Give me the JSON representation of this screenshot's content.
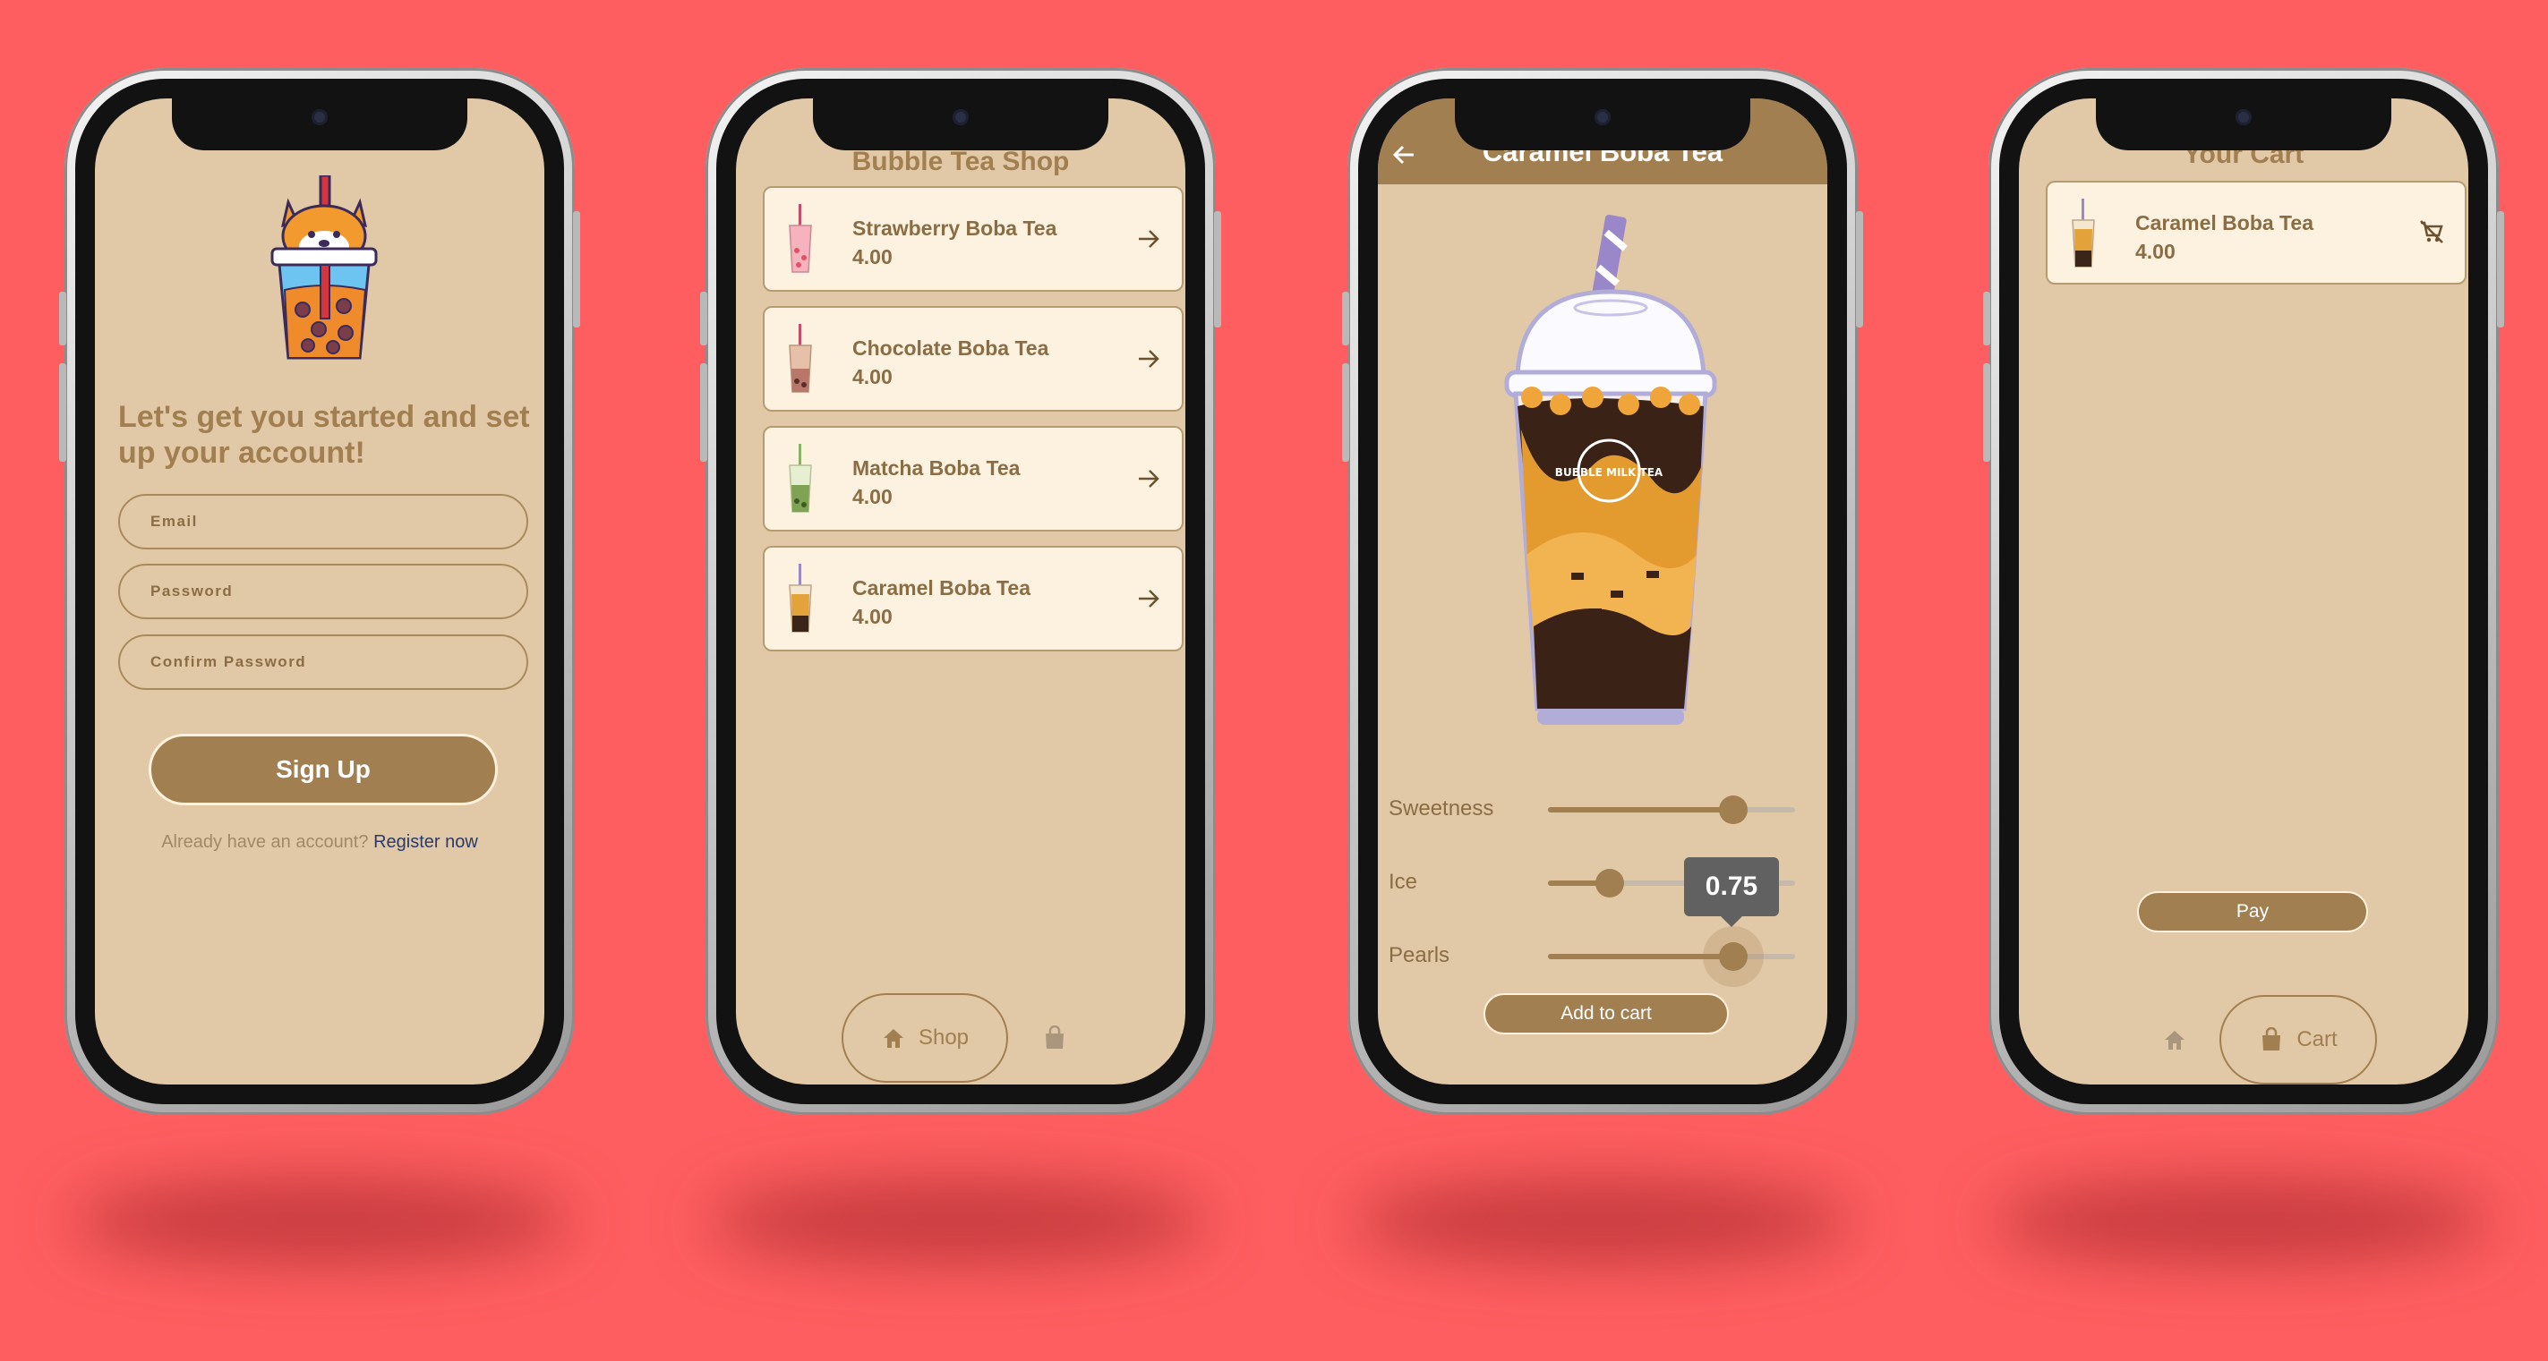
{
  "colors": {
    "background": "#fe5e5f",
    "screen": "#e1c9a7",
    "accent": "#a27f50",
    "card": "#fdf2df"
  },
  "signup": {
    "heading": "Let's get you started and set up your account!",
    "email_placeholder": "Email",
    "password_placeholder": "Password",
    "confirm_placeholder": "Confirm Password",
    "button": "Sign Up",
    "prompt": "Already have an account?",
    "link": "Register now"
  },
  "shop": {
    "title": "Bubble Tea Shop",
    "items": [
      {
        "name": "Strawberry Boba Tea",
        "price": "4.00",
        "icon": "strawberry-tea-icon"
      },
      {
        "name": "Chocolate Boba Tea",
        "price": "4.00",
        "icon": "chocolate-tea-icon"
      },
      {
        "name": "Matcha Boba Tea",
        "price": "4.00",
        "icon": "matcha-tea-icon"
      },
      {
        "name": "Caramel Boba Tea",
        "price": "4.00",
        "icon": "caramel-tea-icon"
      }
    ],
    "nav": {
      "shop_label": "Shop",
      "cart_icon": "bag-icon"
    }
  },
  "detail": {
    "title": "Caramel Boba Tea",
    "cup_logo": "BUBBLE MILK TEA",
    "sliders": [
      {
        "label": "Sweetness",
        "value": 0.75
      },
      {
        "label": "Ice",
        "value": 0.25
      },
      {
        "label": "Pearls",
        "value": 0.75
      }
    ],
    "tooltip": "0.75",
    "add_button": "Add to cart"
  },
  "cart": {
    "title": "Your Cart",
    "items": [
      {
        "name": "Caramel Boba Tea",
        "price": "4.00"
      }
    ],
    "pay_button": "Pay",
    "nav": {
      "cart_label": "Cart"
    }
  }
}
